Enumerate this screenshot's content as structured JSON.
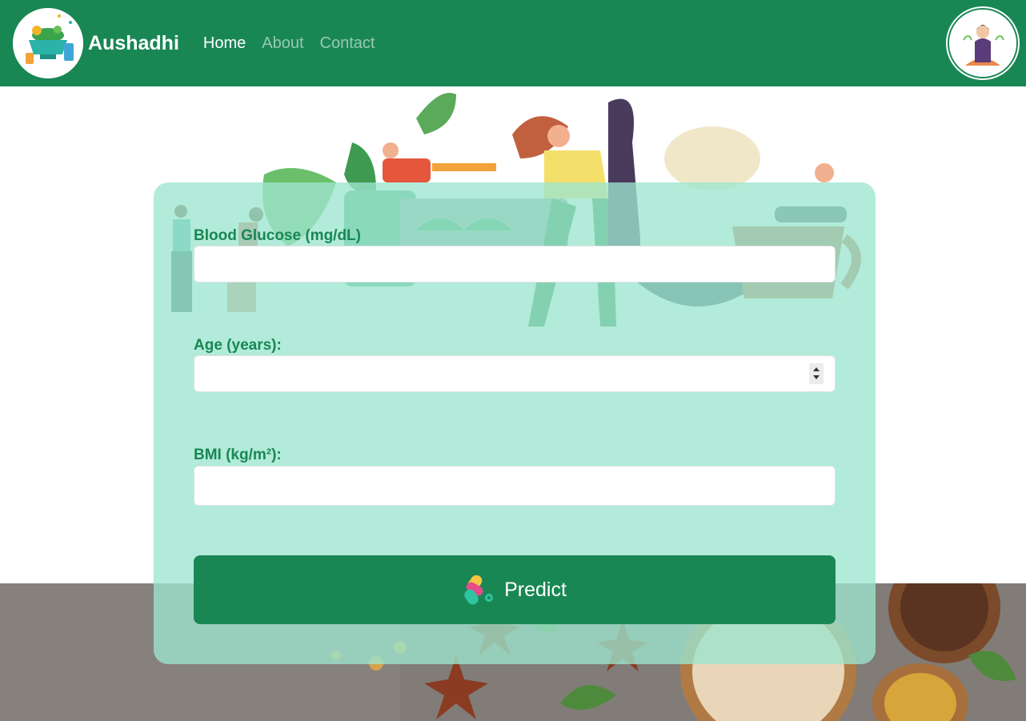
{
  "app": {
    "brand": "Aushadhi"
  },
  "nav": {
    "items": [
      {
        "label": "Home",
        "active": true
      },
      {
        "label": "About",
        "active": false
      },
      {
        "label": "Contact",
        "active": false
      }
    ]
  },
  "form": {
    "glucose": {
      "label": "Blood Glucose (mg/dL)",
      "value": "",
      "placeholder": ""
    },
    "age": {
      "label": "Age (years):",
      "value": "",
      "placeholder": ""
    },
    "bmi": {
      "label": "BMI (kg/m²):",
      "value": "",
      "placeholder": ""
    },
    "predict_label": "Predict"
  },
  "icons": {
    "logo": "herbal-mortar-logo-icon",
    "avatar": "meditating-woman-avatar-icon",
    "predict": "pill-capsules-icon"
  },
  "colors": {
    "primary": "#198754",
    "card_bg": "#9ce6ce",
    "text_on_primary": "#ffffff"
  }
}
